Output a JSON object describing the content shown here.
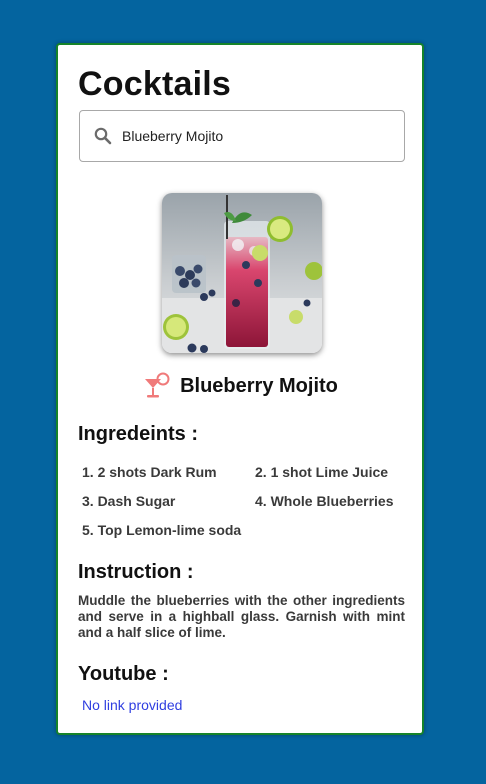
{
  "app": {
    "title": "Cocktails"
  },
  "search": {
    "value": "Blueberry Mojito",
    "icon": "search-icon"
  },
  "drink": {
    "name": "Blueberry Mojito",
    "icon": "cocktail-icon",
    "image_alt": "Blueberry Mojito"
  },
  "ingredients": {
    "heading": "Ingredeints :",
    "items": [
      "1. 2 shots Dark Rum",
      "2. 1 shot Lime Juice",
      "3. Dash Sugar",
      "4. Whole Blueberries",
      "5. Top Lemon-lime soda"
    ]
  },
  "instruction": {
    "heading": "Instruction :",
    "text": "Muddle the blueberries with the other ingredients and serve in a highball glass. Garnish with mint and a half slice of lime."
  },
  "youtube": {
    "heading": "Youtube :",
    "link_text": "No link provided"
  },
  "colors": {
    "background": "#04649f",
    "card_border": "#15832a",
    "link": "#2f3ee0",
    "cocktail_icon": "#f07a7a"
  }
}
